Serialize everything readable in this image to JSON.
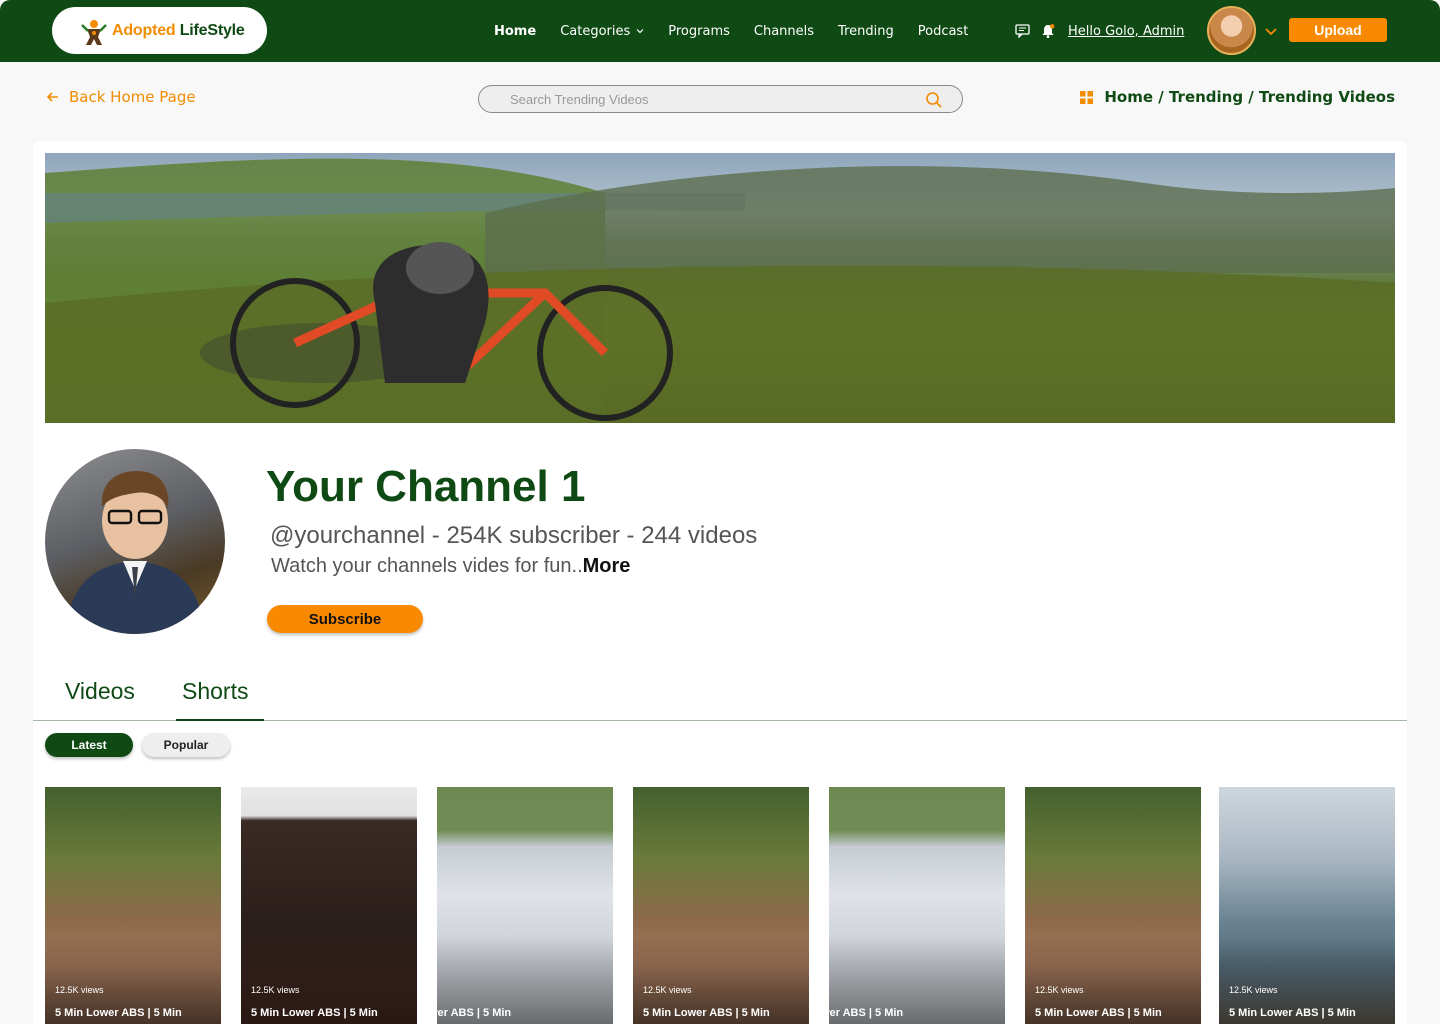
{
  "brand": {
    "part1": "Adopted",
    "part2": " LifeStyle"
  },
  "nav": [
    {
      "label": "Home",
      "active": true
    },
    {
      "label": "Categories",
      "dropdown": true
    },
    {
      "label": "Programs"
    },
    {
      "label": "Channels"
    },
    {
      "label": "Trending"
    },
    {
      "label": "Podcast"
    }
  ],
  "header": {
    "greeting": "Hello Golo, Admin",
    "upload_label": "Upload",
    "icons": [
      "message-icon",
      "bell-icon",
      "chevron-down-icon"
    ]
  },
  "subbar": {
    "back_label": "Back Home Page",
    "search_placeholder": "Search Trending Videos",
    "breadcrumb": "Home / Trending / Trending Videos"
  },
  "channel": {
    "name": "Your Channel 1",
    "meta": "@yourchannel - 254K subscriber - 244 videos",
    "description": "Watch your channels vides for fun..",
    "more_label": "More",
    "subscribe_label": "Subscribe"
  },
  "tabs": [
    {
      "label": "Videos"
    },
    {
      "label": "Shorts",
      "active": true
    }
  ],
  "filters": [
    {
      "label": "Latest",
      "active": true
    },
    {
      "label": "Popular"
    }
  ],
  "shorts": [
    {
      "views": "12.5K views",
      "title": "5 Min Lower ABS | 5 Min"
    },
    {
      "views": "12.5K views",
      "title": "5 Min Lower ABS | 5 Min"
    },
    {
      "views": "s",
      "title": "wer ABS | 5 Min"
    },
    {
      "views": "12.5K views",
      "title": "5 Min Lower ABS | 5 Min"
    },
    {
      "views": "s",
      "title": "wer ABS | 5 Min"
    },
    {
      "views": "12.5K views",
      "title": "5 Min Lower ABS | 5 Min"
    },
    {
      "views": "12.5K views",
      "title": "5 Min Lower ABS | 5 Min"
    }
  ],
  "colors": {
    "brand_green": "#0f4a14",
    "accent_orange": "#f98a00"
  }
}
